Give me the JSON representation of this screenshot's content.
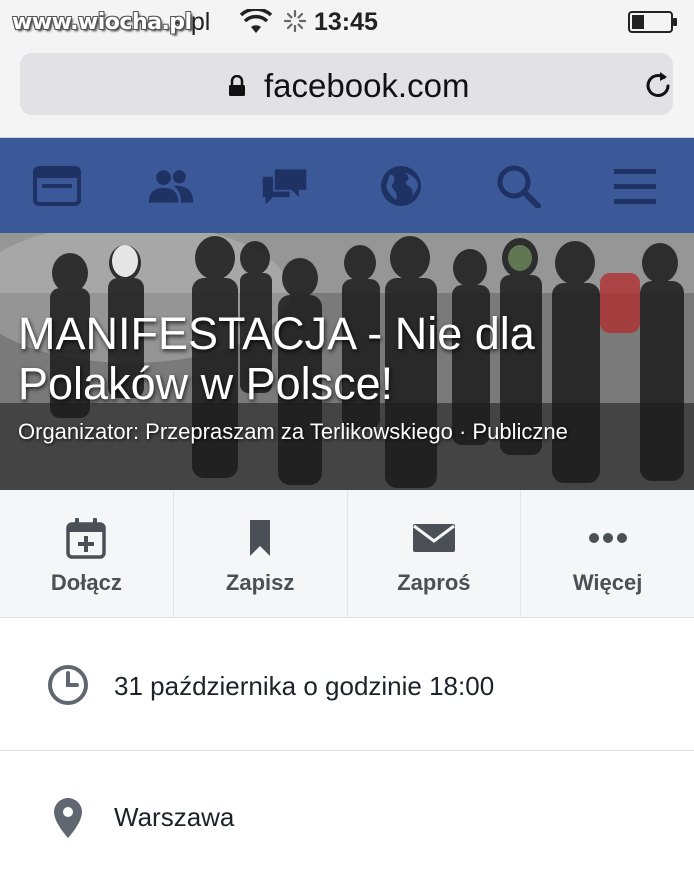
{
  "status_bar": {
    "watermark": "www.wiocha.pl",
    "carrier": "e.pl",
    "time": "13:45"
  },
  "browser": {
    "url": "facebook.com"
  },
  "nav": {
    "items": [
      {
        "icon": "news-feed-icon"
      },
      {
        "icon": "friends-icon"
      },
      {
        "icon": "messages-icon"
      },
      {
        "icon": "notifications-globe-icon"
      },
      {
        "icon": "search-icon"
      },
      {
        "icon": "menu-icon"
      }
    ],
    "color": "#3b5998"
  },
  "event": {
    "title": "MANIFESTACJA - Nie dla Polaków w Polsce!",
    "organizer": "Organizator: Przepraszam za Terlikowskiego · Publiczne"
  },
  "actions": [
    {
      "label": "Dołącz",
      "icon": "calendar-add-icon"
    },
    {
      "label": "Zapisz",
      "icon": "bookmark-icon"
    },
    {
      "label": "Zaproś",
      "icon": "envelope-icon"
    },
    {
      "label": "Więcej",
      "icon": "more-dots-icon"
    }
  ],
  "details": {
    "time": "31 października o godzinie 18:00",
    "place": "Warszawa"
  },
  "colors": {
    "icon_gray": "#4b4f56",
    "detail_icon": "#606770"
  }
}
